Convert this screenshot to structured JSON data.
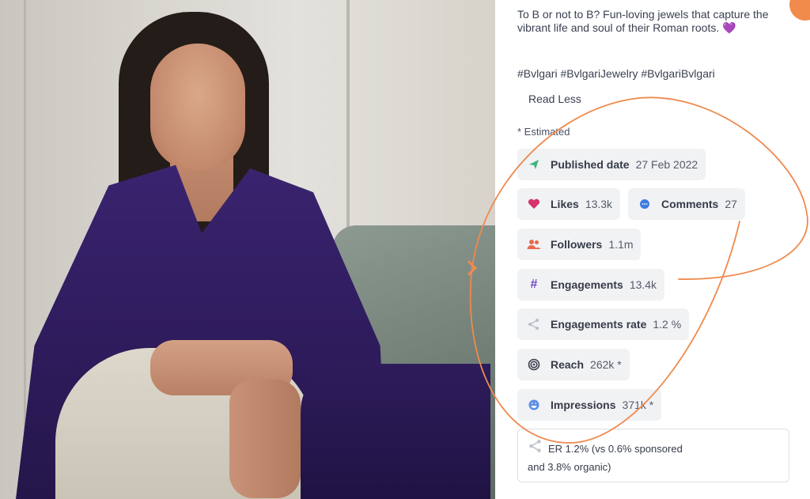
{
  "post": {
    "caption": "To B or not to B? Fun-loving jewels that capture the vibrant life and soul of their Roman roots. 💜",
    "hashtags": "#Bvlgari #BvlgariJewelry #BvlgariBvlgari",
    "read_less": "Read Less",
    "estimated_note": "* Estimated"
  },
  "stats": {
    "published": {
      "label": "Published date",
      "value": "27 Feb 2022"
    },
    "likes": {
      "label": "Likes",
      "value": "13.3k"
    },
    "comments": {
      "label": "Comments",
      "value": "27"
    },
    "followers": {
      "label": "Followers",
      "value": "1.1m"
    },
    "engagements": {
      "label": "Engagements",
      "value": "13.4k"
    },
    "engagements_rate": {
      "label": "Engagements rate",
      "value": "1.2 %"
    },
    "reach": {
      "label": "Reach",
      "value": "262k *"
    },
    "impressions": {
      "label": "Impressions",
      "value": "371k *"
    }
  },
  "er_summary": {
    "line1": "ER 1.2% (vs 0.6% sponsored",
    "line2": "and 3.8% organic)"
  },
  "icons": {
    "published": "send-icon",
    "likes": "heart-icon",
    "comments": "chat-bubble-icon",
    "followers": "users-icon",
    "engagements": "hash-icon",
    "engagements_rate": "share-icon",
    "reach": "target-icon",
    "impressions": "smiley-icon"
  },
  "colors": {
    "accent": "#ef8a4e",
    "heart": "#d6336c",
    "comment": "#3d7be0",
    "users": "#e8684a",
    "hash": "#6b46c1",
    "chip_bg": "#f1f2f4"
  }
}
